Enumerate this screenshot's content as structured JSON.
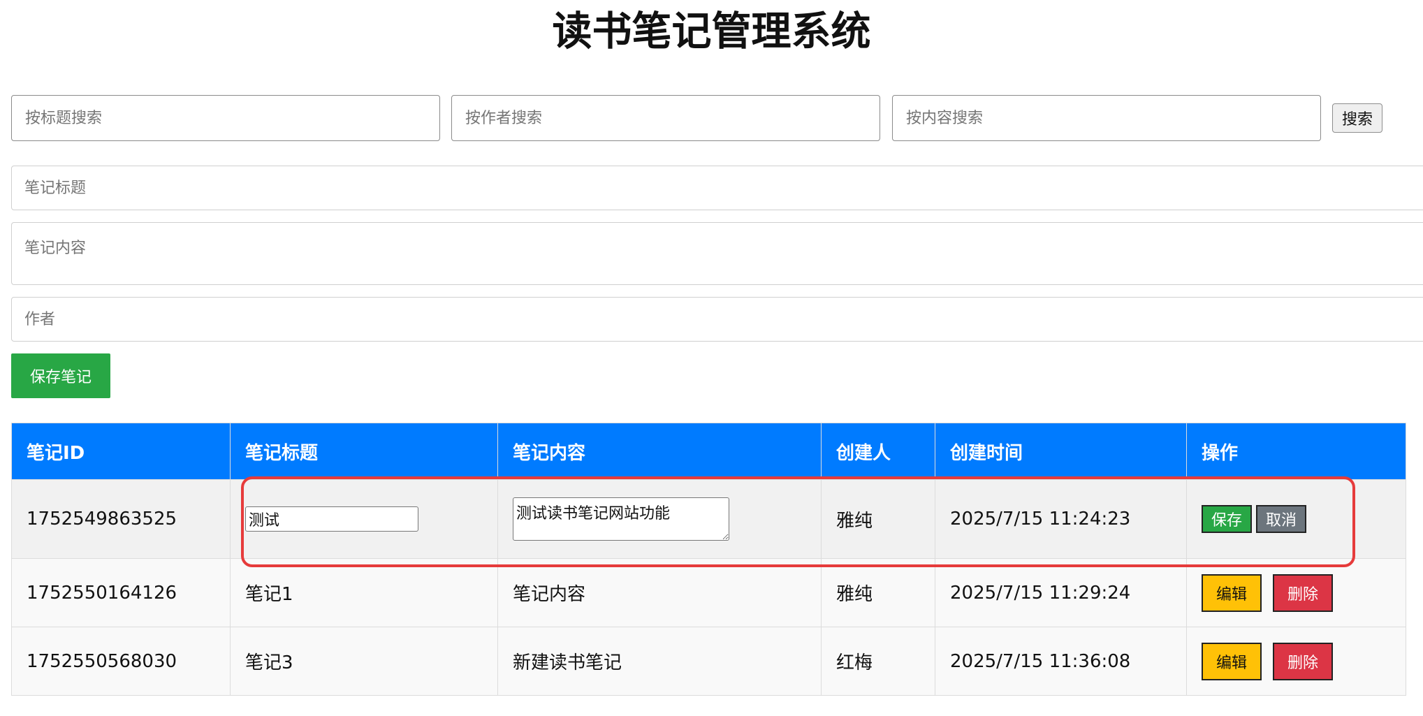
{
  "page": {
    "title": "读书笔记管理系统"
  },
  "search": {
    "title_placeholder": "按标题搜索",
    "author_placeholder": "按作者搜索",
    "content_placeholder": "按内容搜索",
    "button_label": "搜索"
  },
  "form": {
    "title_placeholder": "笔记标题",
    "content_placeholder": "笔记内容",
    "author_placeholder": "作者",
    "save_label": "保存笔记"
  },
  "table": {
    "headers": [
      "笔记ID",
      "笔记标题",
      "笔记内容",
      "创建人",
      "创建时间",
      "操作"
    ],
    "rows": [
      {
        "id": "1752549863525",
        "title": "测试",
        "content": "测试读书笔记网站功能",
        "creator": "雅纯",
        "created_at": "2025/7/15 11:24:23",
        "editing": true,
        "actions": [
          "保存",
          "取消"
        ]
      },
      {
        "id": "1752550164126",
        "title": "笔记1",
        "content": "笔记内容",
        "creator": "雅纯",
        "created_at": "2025/7/15 11:29:24",
        "editing": false,
        "actions": [
          "编辑",
          "删除"
        ]
      },
      {
        "id": "1752550568030",
        "title": "笔记3",
        "content": "新建读书笔记",
        "creator": "红梅",
        "created_at": "2025/7/15 11:36:08",
        "editing": false,
        "actions": [
          "编辑",
          "删除"
        ]
      }
    ]
  },
  "colors": {
    "header_blue": "#007bff",
    "save_green": "#28a745",
    "cancel_gray": "#6c757d",
    "edit_yellow": "#ffc107",
    "delete_red": "#dc3545",
    "highlight_red": "#e63b3b"
  }
}
